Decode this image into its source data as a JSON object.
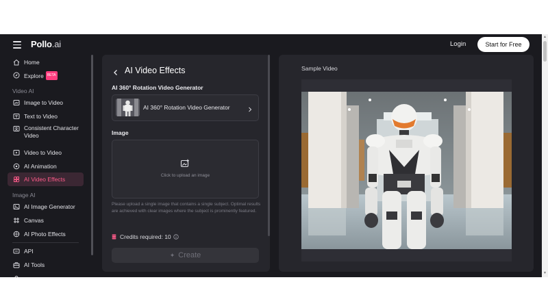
{
  "topbar": {
    "logo_main": "Pollo",
    "logo_suffix": ".ai",
    "login": "Login",
    "start_free": "Start for Free"
  },
  "sidebar": {
    "home": "Home",
    "explore": "Explore",
    "explore_badge": "BETA",
    "section_video": "Video AI",
    "video_items": [
      "Image to Video",
      "Text to Video",
      "Consistent Character Video",
      "Video to Video",
      "AI Animation",
      "AI Video Effects"
    ],
    "section_image": "Image AI",
    "image_items": [
      "AI Image Generator",
      "Canvas",
      "AI Photo Effects"
    ],
    "api": "API",
    "ai_tools": "AI Tools",
    "active_item": "AI Video Effects"
  },
  "left_panel": {
    "title": "AI Video Effects",
    "generator_heading": "AI 360° Rotation Video Generator",
    "generator_selected": "AI 360° Rotation Video Generator",
    "image_heading": "Image",
    "upload_text": "Click to upload an image",
    "help_text": "Please upload a single image that contains a single subject. Optimal results are achieved with clear images where the subject is prominently featured.",
    "credits_text": "Credits required: 10",
    "create_label": "Create"
  },
  "right_panel": {
    "title": "Sample Video"
  },
  "colors": {
    "accent": "#ff5b8a",
    "background": "#1a1a1f",
    "panel": "#26262c",
    "active_bg": "#3b2733"
  }
}
